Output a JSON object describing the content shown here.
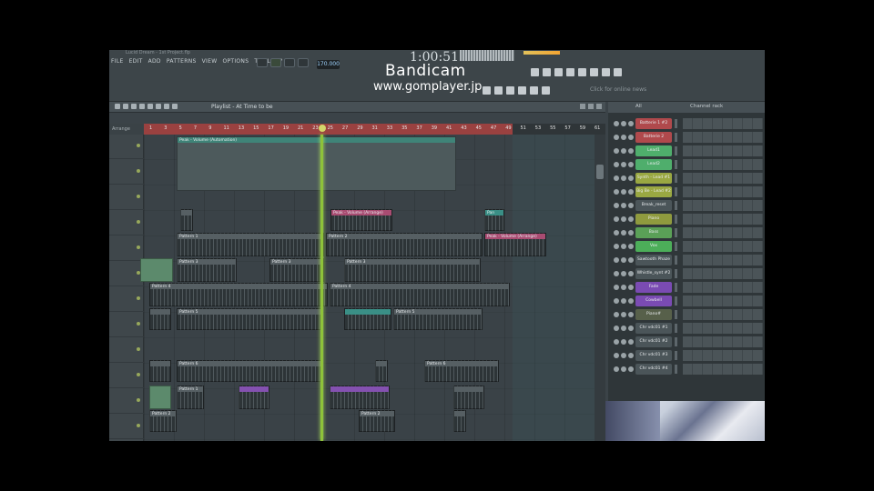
{
  "window": {
    "title_hint": "Lucid Dream - 1st Project.flp",
    "menu": [
      "FILE",
      "EDIT",
      "ADD",
      "PATTERNS",
      "VIEW",
      "OPTIONS",
      "TOOLS",
      "?"
    ],
    "tempo": "170.000",
    "timecode": "1:00:51",
    "click_hint": "Click for online news"
  },
  "watermark": {
    "line1": "Bandicam",
    "line2": "www.gomplayer.jp"
  },
  "playlist": {
    "title": "Playlist - At Time to be",
    "ruler_ticks": [
      "1",
      "3",
      "5",
      "7",
      "9",
      "11",
      "13",
      "15",
      "17",
      "19",
      "21",
      "23",
      "25",
      "27",
      "29",
      "31",
      "33",
      "35",
      "37",
      "39",
      "41",
      "43",
      "45",
      "47",
      "49",
      "51",
      "53",
      "55",
      "57",
      "59",
      "61"
    ],
    "ruler_label": "Arrange",
    "clips": {
      "auto1": "Peak - Volume (Automation)",
      "auto2": "Peak - Volume (Arrange)",
      "auto3": "Pan",
      "auto4": "Peak - Volume (Arrange)",
      "pat": "Pattern 1",
      "pat2": "Pattern 2",
      "pat3": "Pattern 3",
      "pat4": "Pattern 4",
      "pat5": "Pattern 5",
      "pat6": "Pattern 6"
    }
  },
  "channel_rack": {
    "title": "Channel rack",
    "filter": "All",
    "channels": [
      {
        "name": "Batterie 1 #2",
        "color": "#b0494c"
      },
      {
        "name": "Batterie 2",
        "color": "#b0494c"
      },
      {
        "name": "Lead1",
        "color": "#4fae6c"
      },
      {
        "name": "Lead2",
        "color": "#4fae6c"
      },
      {
        "name": "Synth - Lead #1",
        "color": "#9aa842"
      },
      {
        "name": "Big Be - Lead #2",
        "color": "#9aa842"
      },
      {
        "name": "Break_reset",
        "color": "#4b5559"
      },
      {
        "name": "Piano",
        "color": "#8f9a3e"
      },
      {
        "name": "Bass",
        "color": "#5aa057"
      },
      {
        "name": "Vox",
        "color": "#4cae59"
      },
      {
        "name": "Sawtooth Phaze",
        "color": "#4b5559"
      },
      {
        "name": "Whistle_synt #2",
        "color": "#4b5559"
      },
      {
        "name": "Fade",
        "color": "#7a4bb3"
      },
      {
        "name": "Cowbell",
        "color": "#7a4bb3"
      },
      {
        "name": "Piano#",
        "color": "#57604a"
      },
      {
        "name": "Chr vdc01 #1",
        "color": "#4b5559"
      },
      {
        "name": "Chr vdc01 #2",
        "color": "#4b5559"
      },
      {
        "name": "Chr vdc01 #3",
        "color": "#4b5559"
      },
      {
        "name": "Chr vdc01 #4",
        "color": "#4b5559"
      }
    ]
  }
}
